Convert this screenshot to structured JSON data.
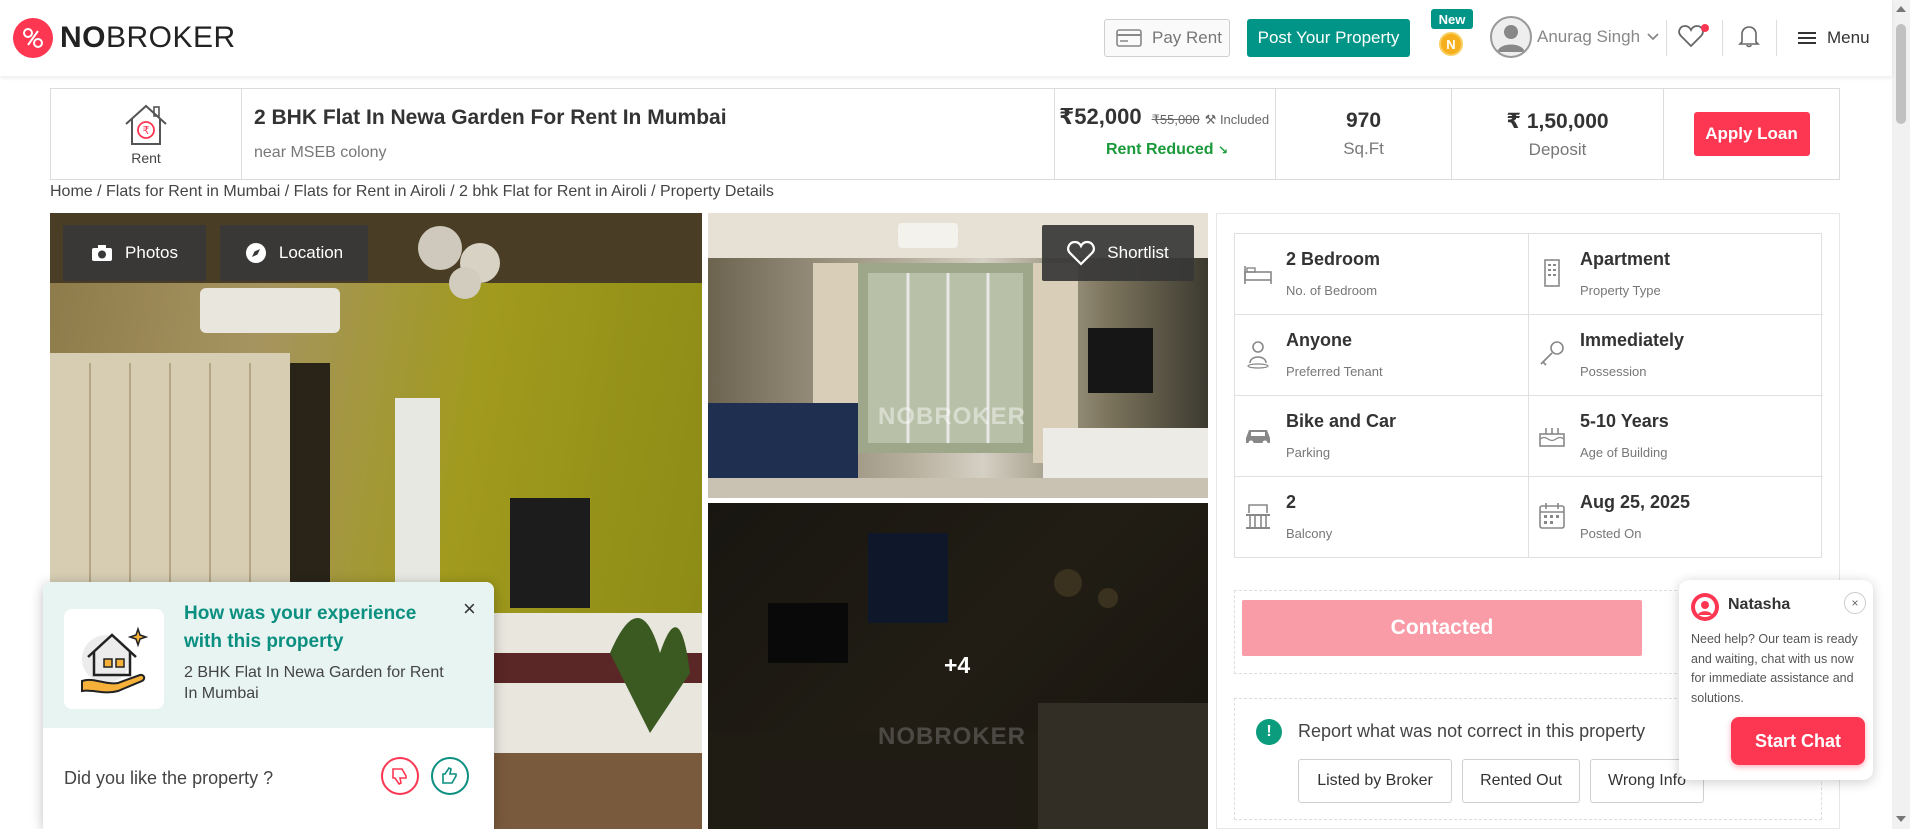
{
  "header": {
    "logo_bold": "NO",
    "logo_rest": "BROKER",
    "pay_rent": "Pay Rent",
    "post_property": "Post Your Property",
    "new_badge": "New",
    "coin_letter": "N",
    "user_name": "Anurag Singh",
    "menu": "Menu"
  },
  "summary": {
    "rent_label": "Rent",
    "title": "2 BHK Flat In Newa Garden For Rent In Mumbai",
    "subtitle": "near MSEB colony",
    "price": "₹52,000",
    "old_price": "₹55,000",
    "included": "Included",
    "rent_reduced": "Rent Reduced",
    "area_value": "970",
    "area_unit": "Sq.Ft",
    "deposit_value": "₹ 1,50,000",
    "deposit_label": "Deposit",
    "apply_loan": "Apply Loan"
  },
  "breadcrumb": "Home / Flats for Rent in Mumbai / Flats for Rent in Airoli / 2 bhk Flat for Rent in Airoli / Property Details",
  "gallery": {
    "photos_btn": "Photos",
    "location_btn": "Location",
    "shortlist_btn": "Shortlist",
    "more_count": "+4",
    "watermark": "NOBROKER"
  },
  "details": [
    {
      "value": "2 Bedroom",
      "label": "No. of Bedroom",
      "icon": "bed-icon"
    },
    {
      "value": "Apartment",
      "label": "Property Type",
      "icon": "building-icon"
    },
    {
      "value": "Anyone",
      "label": "Preferred Tenant",
      "icon": "tenant-icon"
    },
    {
      "value": "Immediately",
      "label": "Possession",
      "icon": "key-icon"
    },
    {
      "value": "Bike and Car",
      "label": "Parking",
      "icon": "car-icon"
    },
    {
      "value": "5-10 Years",
      "label": "Age of Building",
      "icon": "cake-icon"
    },
    {
      "value": "2",
      "label": "Balcony",
      "icon": "balcony-icon"
    },
    {
      "value": "Aug 25, 2025",
      "label": "Posted On",
      "icon": "calendar-icon"
    }
  ],
  "contact": {
    "contacted": "Contacted"
  },
  "report": {
    "title": "Report what was not correct in this property",
    "buttons": [
      "Listed by Broker",
      "Rented Out",
      "Wrong Info"
    ]
  },
  "feedback": {
    "question": "How was your experience with this property",
    "property_name": "2 BHK Flat In Newa Garden for Rent In Mumbai",
    "like_prompt": "Did you like the property ?",
    "close": "×"
  },
  "chat": {
    "agent_name": "Natasha",
    "message": "Need help? Our team is ready and waiting, chat with us now for immediate assistance and solutions.",
    "start_chat": "Start Chat",
    "close": "×"
  },
  "colors": {
    "brand_red": "#fd3752",
    "brand_teal": "#009587",
    "rent_reduced_green": "#1a9a3a",
    "contacted_pink": "#f99ca8"
  }
}
